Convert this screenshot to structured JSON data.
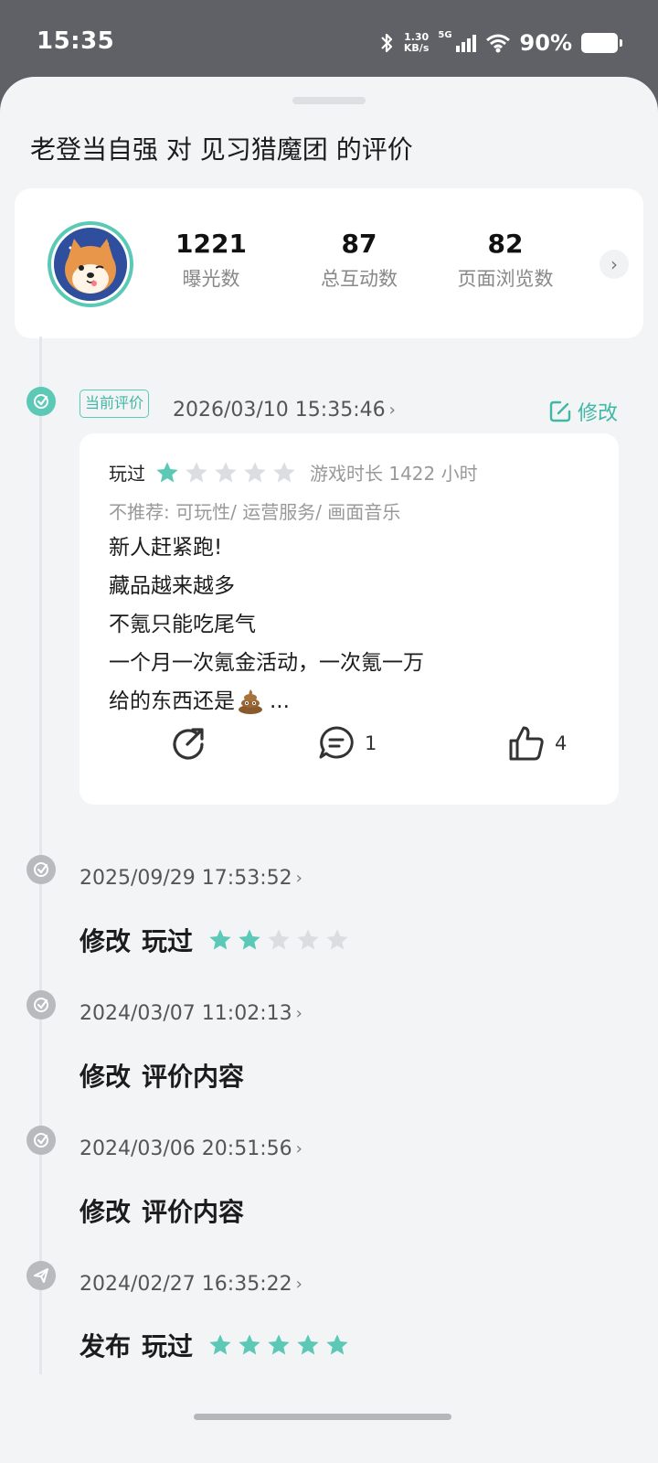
{
  "status_bar": {
    "time": "15:35",
    "net_speed_value": "1.30",
    "net_speed_unit": "KB/s",
    "network": "5G",
    "battery": "90%"
  },
  "sheet": {
    "title": "老登当自强 对 见习猎魔团 的评价"
  },
  "stats": {
    "items": [
      {
        "value": "1221",
        "label": "曝光数"
      },
      {
        "value": "87",
        "label": "总互动数"
      },
      {
        "value": "82",
        "label": "页面浏览数"
      }
    ],
    "chevron": "›"
  },
  "current_review": {
    "tag": "当前评价",
    "timestamp": "2026/03/10 15:35:46",
    "edit_label": "修改",
    "played_label": "玩过",
    "rating": 1,
    "duration": "游戏时长 1422 小时",
    "not_recommend": "不推荐: 可玩性/ 运营服务/ 画面音乐",
    "body_lines": [
      "新人赶紧跑!",
      "藏品越来越多",
      "不氪只能吃尾气",
      "一个月一次氪金活动，一次氪一万",
      "给的东西还是"
    ],
    "body_ellipsis": "...",
    "comment_count": "1",
    "like_count": "4"
  },
  "history": [
    {
      "timestamp": "2025/09/29 17:53:52",
      "action": "修改",
      "detail": "玩过",
      "rating": 2,
      "icon": "check-circle-icon"
    },
    {
      "timestamp": "2024/03/07 11:02:13",
      "action": "修改",
      "detail": "评价内容",
      "icon": "check-circle-icon"
    },
    {
      "timestamp": "2024/03/06 20:51:56",
      "action": "修改",
      "detail": "评价内容",
      "icon": "check-circle-icon"
    },
    {
      "timestamp": "2024/02/27 16:35:22",
      "action": "发布",
      "detail": "玩过",
      "rating": 5,
      "icon": "send-icon"
    }
  ],
  "colors": {
    "accent": "#5cc9b7",
    "star_empty": "#dcdde0"
  }
}
